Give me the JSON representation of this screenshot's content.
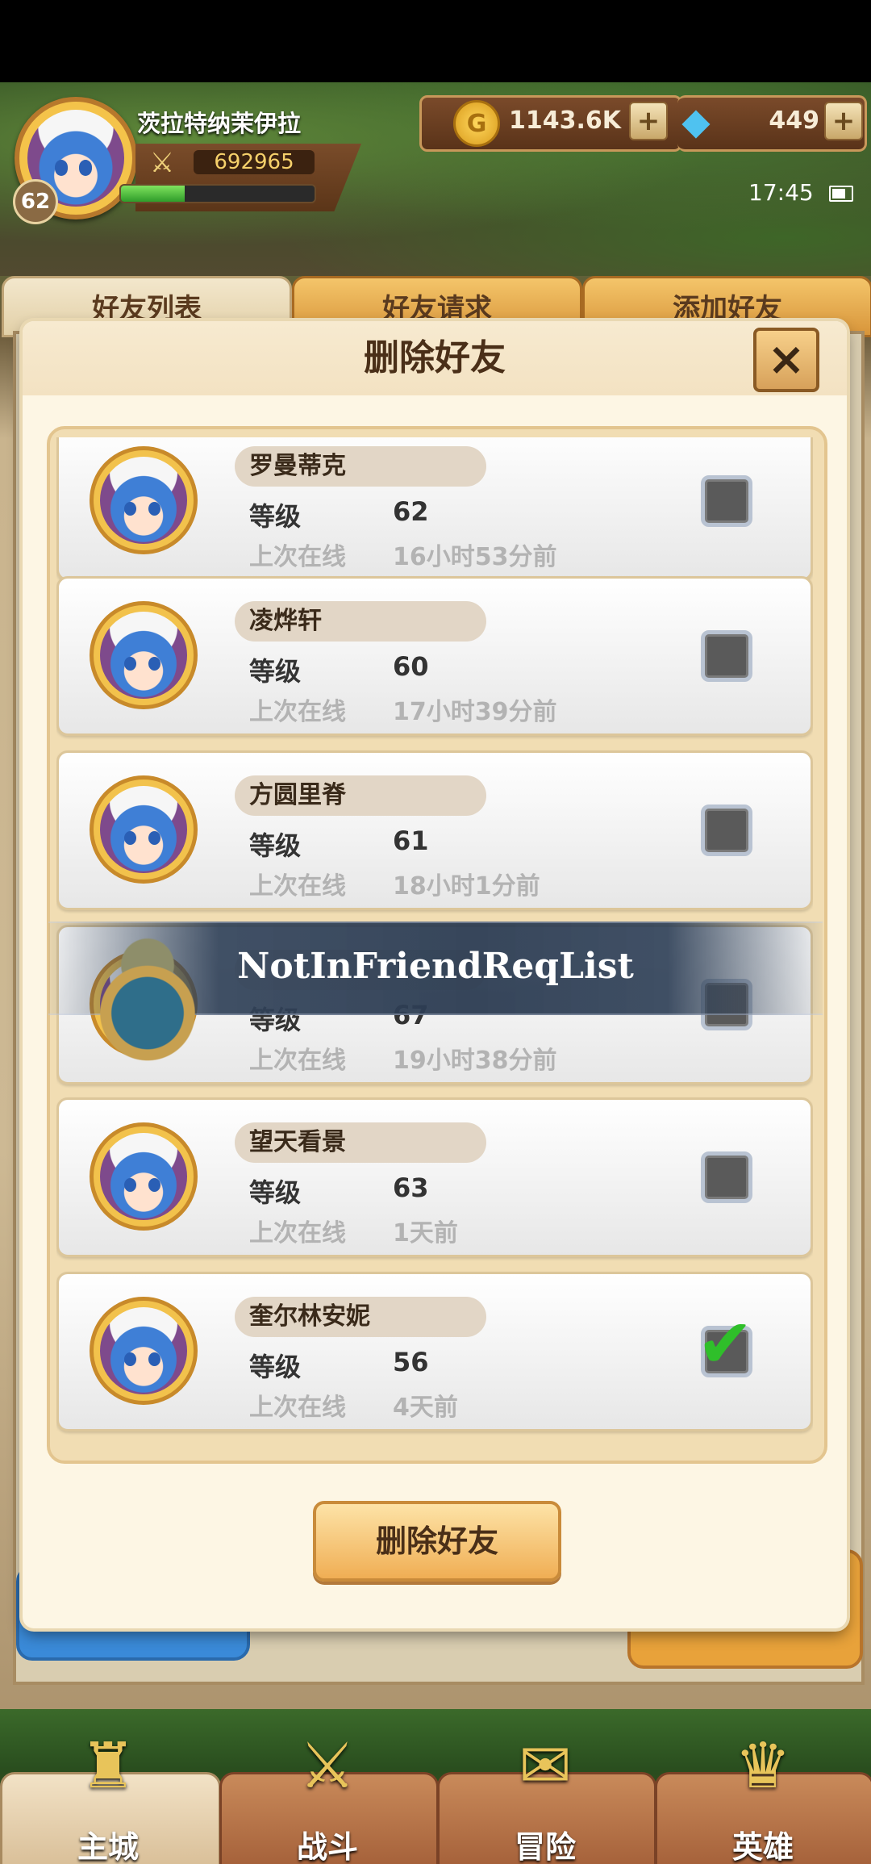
{
  "player": {
    "name": "茨拉特纳茉伊拉",
    "level": "62",
    "power": "692965",
    "xp_fraction": 0.33
  },
  "currency": {
    "gold": "1143.6K",
    "gems": "449",
    "plus": "+"
  },
  "status": {
    "time": "17:45"
  },
  "tabs": [
    "好友列表",
    "好友请求",
    "添加好友"
  ],
  "modal": {
    "title": "删除好友",
    "close": "×",
    "confirm_button": "删除好友"
  },
  "labels": {
    "level": "等级",
    "last_online": "上次在线"
  },
  "friends": [
    {
      "name": "罗曼蒂克",
      "level": "62",
      "last_online": "16小时53分前",
      "checked": false
    },
    {
      "name": "凌烨轩",
      "level": "60",
      "last_online": "17小时39分前",
      "checked": false
    },
    {
      "name": "方圆里脊",
      "level": "61",
      "last_online": "18小时1分前",
      "checked": false
    },
    {
      "name": "",
      "level": "67",
      "last_online": "19小时38分前",
      "checked": false
    },
    {
      "name": "望天看景",
      "level": "63",
      "last_online": "1天前",
      "checked": false
    },
    {
      "name": "奎尔林安妮",
      "level": "56",
      "last_online": "4天前",
      "checked": true
    }
  ],
  "overlay": {
    "text": "NotInFriendReqList"
  },
  "nav": [
    {
      "label": "主城",
      "icon": "castle-icon",
      "active": true
    },
    {
      "label": "战斗",
      "icon": "crossed-swords-icon",
      "active": false
    },
    {
      "label": "冒险",
      "icon": "scroll-map-icon",
      "active": false
    },
    {
      "label": "英雄",
      "icon": "hero-helmet-icon",
      "active": false
    }
  ],
  "colors": {
    "accent": "#f0ae54",
    "check": "#2fbf2a",
    "banner": "#2c3c52"
  }
}
